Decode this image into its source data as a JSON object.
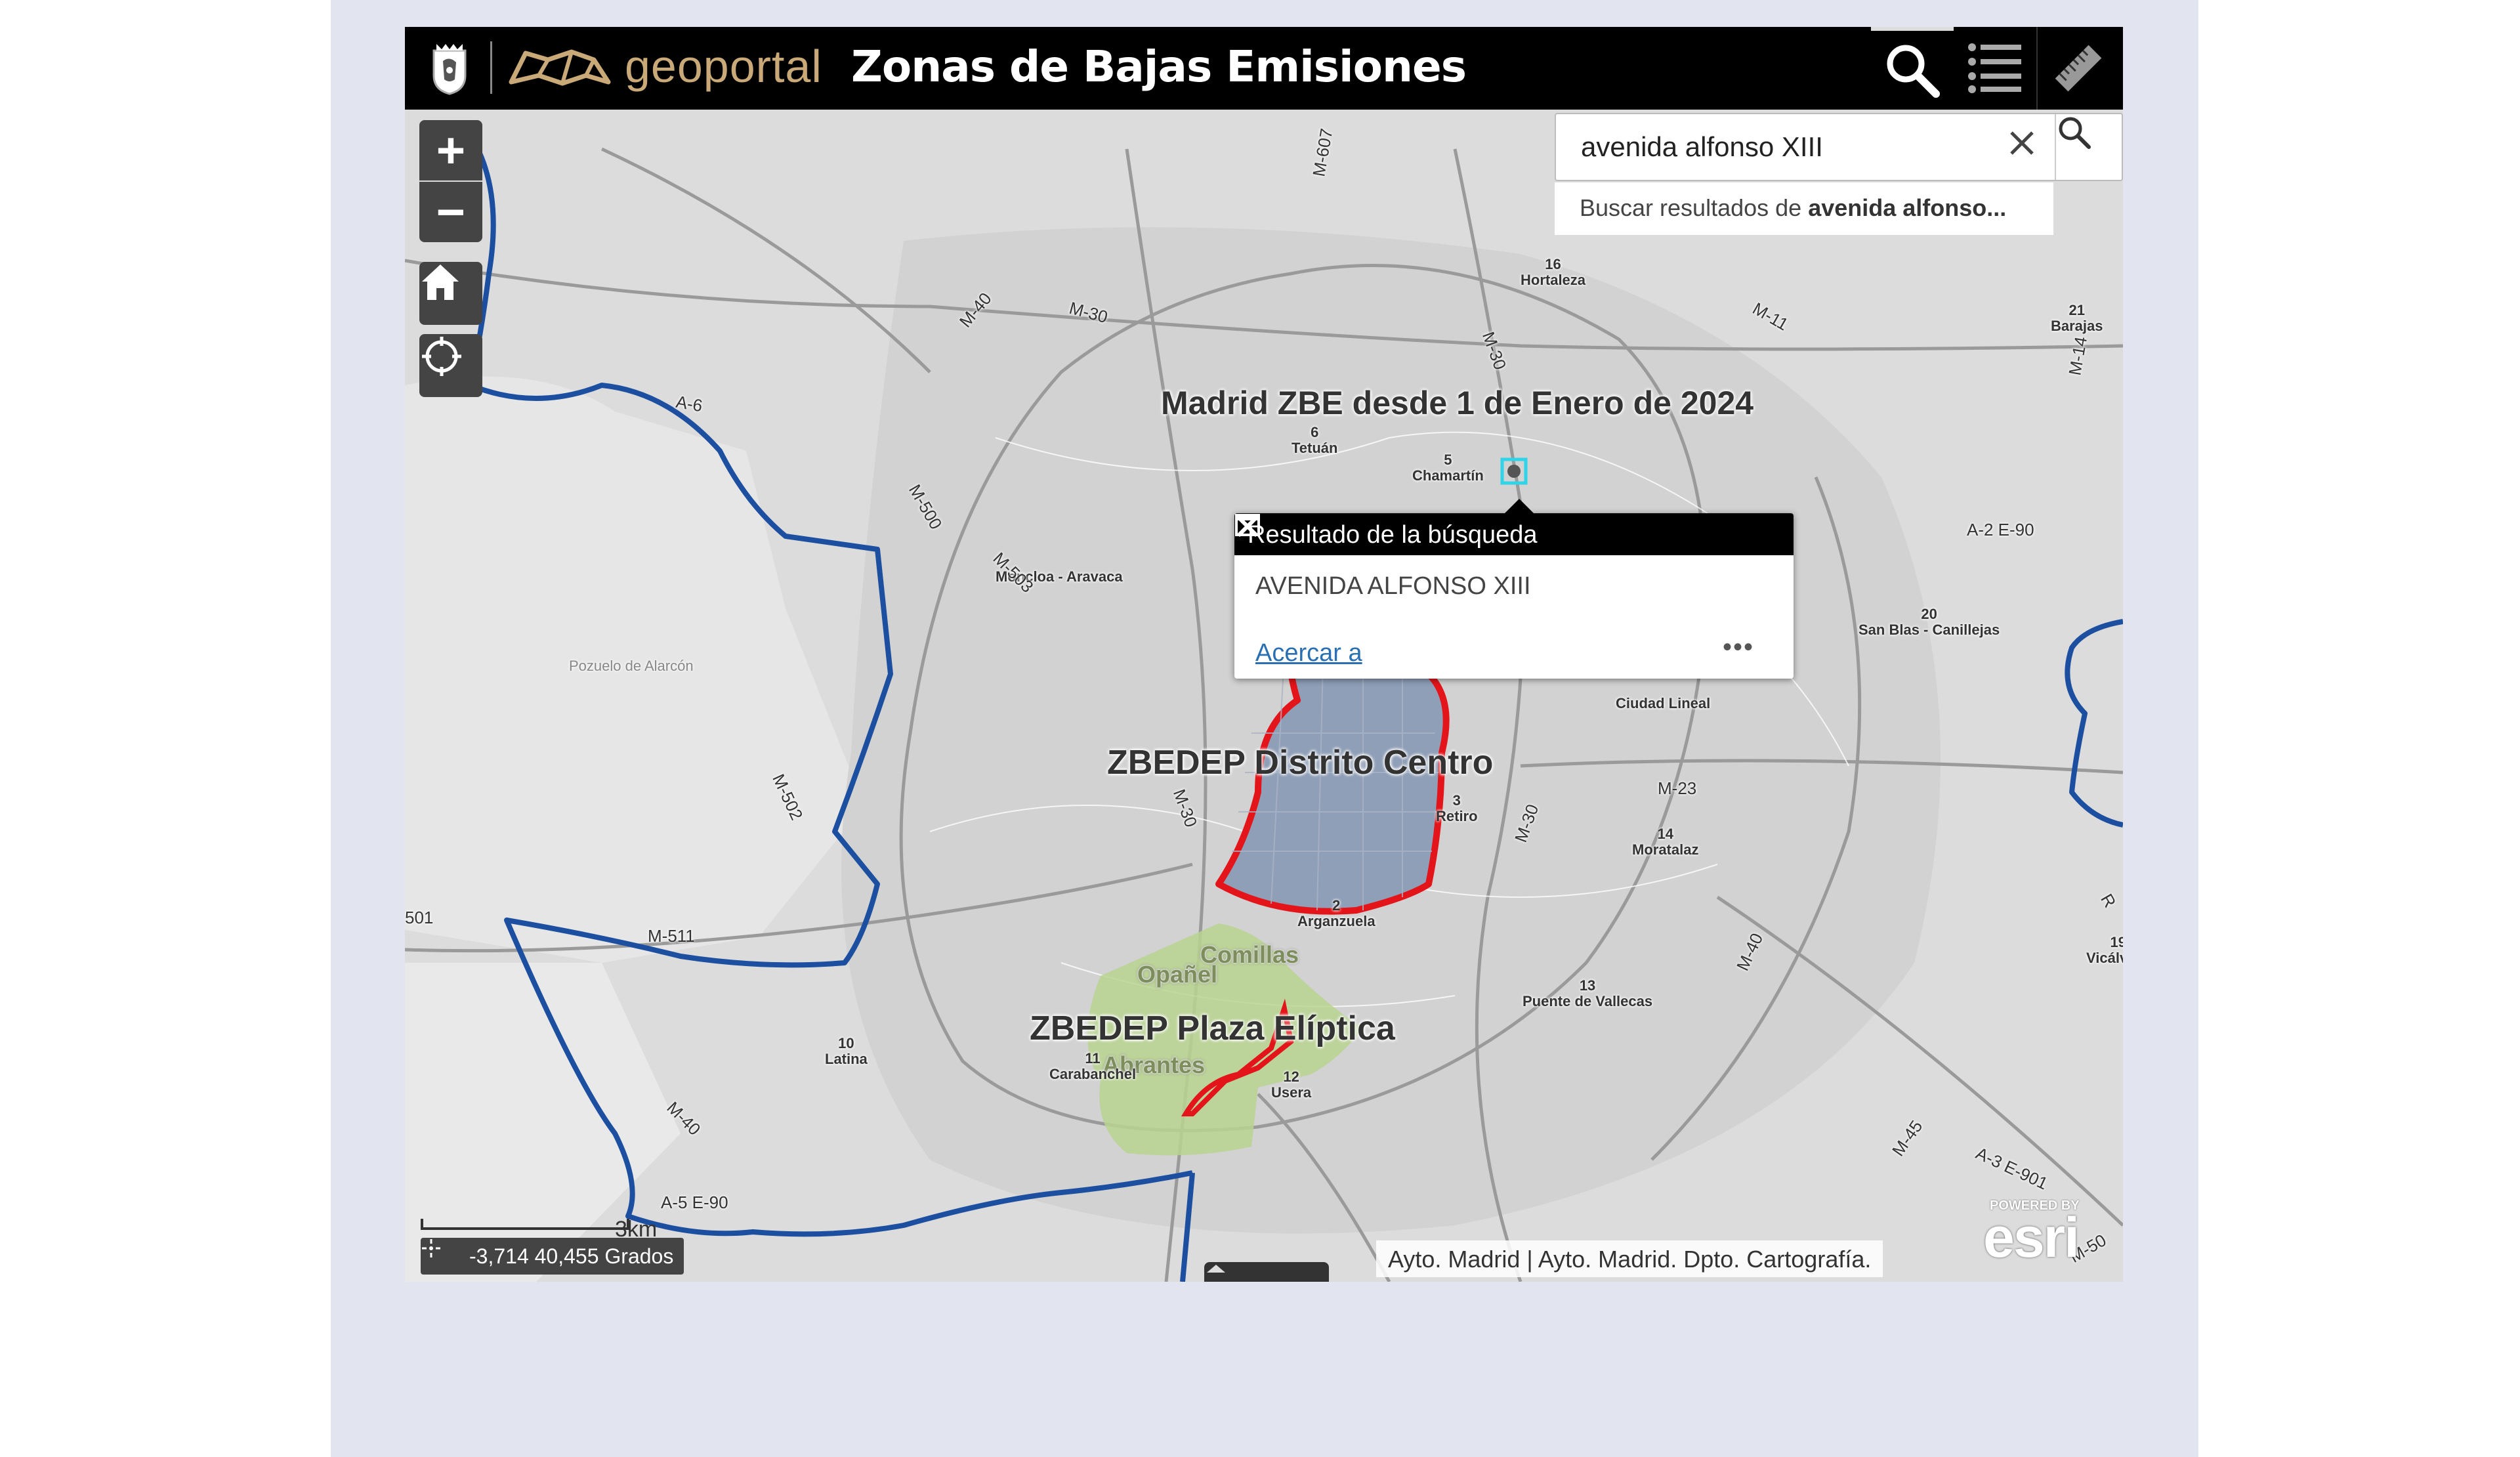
{
  "header": {
    "logo_text": "geoportal",
    "title": "Zonas de Bajas Emisiones",
    "icons": [
      "city-crest-icon",
      "geoportal-logo-icon",
      "search-icon",
      "layer-list-icon",
      "measure-ruler-icon"
    ]
  },
  "map_controls": {
    "zoom_in": "+",
    "zoom_out": "−",
    "icons": [
      "home-icon",
      "locate-icon"
    ]
  },
  "search": {
    "value": "avenida alfonso XIII",
    "suggestion_prefix": "Buscar resultados de ",
    "suggestion_term": "avenida alfonso..."
  },
  "popup": {
    "title": "Resultado de la búsqueda",
    "result": "AVENIDA ALFONSO XIII",
    "zoom_link": "Acercar a",
    "more": "•••"
  },
  "zones": {
    "madrid_zbe": "Madrid ZBE desde 1 de Enero de 2024",
    "centro": "ZBEDEP Distrito Centro",
    "eliptica": "ZBEDEP Plaza Elíptica",
    "comillas": "Comillas",
    "opanel": "Opañel",
    "abrantes": "Abrantes"
  },
  "districts": {
    "hortaleza_num": "16",
    "hortaleza": "Hortaleza",
    "barajas_num": "21",
    "barajas": "Barajas",
    "tetuan_num": "6",
    "tetuan": "Tetuán",
    "chamartin_num": "5",
    "chamartin": "Chamartín",
    "moncloa": "Moncloa - Aravaca",
    "sanblas_num": "20",
    "sanblas": "San Blas - Canillejas",
    "ciudadlineal": "Ciudad Lineal",
    "retiro_num": "3",
    "retiro": "Retiro",
    "moratalaz_num": "14",
    "moratalaz": "Moratalaz",
    "arganzuela_num": "2",
    "arganzuela": "Arganzuela",
    "vicalvaro_num": "19",
    "vicalvaro": "Vicálvaro",
    "vallecas_num": "13",
    "vallecas": "Puente de Vallecas",
    "latina_num": "10",
    "latina": "Latina",
    "carabanchel_num": "11",
    "carabanchel": "Carabanchel",
    "usera_num": "12",
    "usera": "Usera",
    "pozuelo": "Pozuelo de Alarcón"
  },
  "roads": {
    "m607": "M-607",
    "m40a": "M-40",
    "m30a": "M-30",
    "m30b": "M-30",
    "m11": "M-11",
    "m14": "M-14",
    "a6": "A-6",
    "m500": "M-500",
    "m503": "M-503",
    "a2": "A-2 E-90",
    "m30c": "M-30",
    "m23": "M-23",
    "m30d": "M-30",
    "m502": "M-502",
    "m511": "M-511",
    "m40b": "M-40",
    "m40c": "M-40",
    "m45": "M-45",
    "a3": "A-3 E-901",
    "a5": "A-5 E-90",
    "m50": "M-50",
    "r": "R",
    "m501": "501"
  },
  "scale_bar": "3km",
  "coordinates": "-3,714 40,455 Grados",
  "attribution": "Ayto. Madrid | Ayto. Madrid. Dpto. Cartografía.",
  "esri": {
    "powered": "POWERED BY",
    "brand": "esri"
  },
  "colors": {
    "header_bg": "#000000",
    "accent_gold": "#c9a977",
    "madrid_boundary": "#1c4fa0",
    "zbedep_boundary": "#e3151a",
    "eliptica_fill": "#b9d48f",
    "map_bg": "#dcdcdc",
    "page_bg": "#e2e5ef"
  }
}
